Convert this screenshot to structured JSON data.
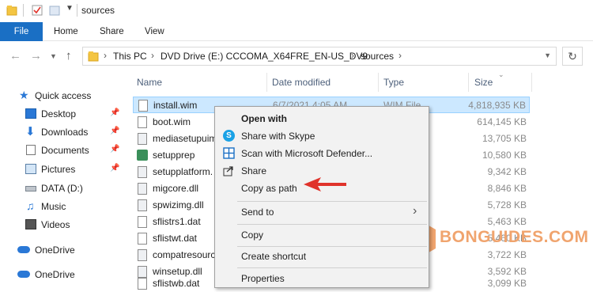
{
  "window": {
    "title": "sources"
  },
  "ribbon": {
    "tabs": [
      "File",
      "Home",
      "Share",
      "View"
    ]
  },
  "address": {
    "crumbs": [
      "This PC",
      "DVD Drive (E:) CCCOMA_X64FRE_EN-US_DV9",
      "sources"
    ]
  },
  "sidebar": {
    "quick_access": "Quick access",
    "items": [
      "Desktop",
      "Downloads",
      "Documents",
      "Pictures",
      "DATA (D:)",
      "Music",
      "Videos",
      "OneDrive",
      "OneDrive"
    ]
  },
  "columns": {
    "name": "Name",
    "date": "Date modified",
    "type": "Type",
    "size": "Size"
  },
  "files": [
    {
      "name": "install.wim",
      "date": "6/7/2021 4:05 AM",
      "type": "WIM File",
      "size": "4,818,935 KB"
    },
    {
      "name": "boot.wim",
      "date": "",
      "type": "",
      "size": "614,145 KB"
    },
    {
      "name": "mediasetupuim",
      "date": "",
      "type": "exten...",
      "size": "13,705 KB"
    },
    {
      "name": "setupprep",
      "date": "",
      "type": "",
      "size": "10,580 KB"
    },
    {
      "name": "setupplatform.",
      "date": "",
      "type": "exten...",
      "size": "9,342 KB"
    },
    {
      "name": "migcore.dll",
      "date": "",
      "type": "exten...",
      "size": "8,846 KB"
    },
    {
      "name": "spwizimg.dll",
      "date": "",
      "type": "exten...",
      "size": "5,728 KB"
    },
    {
      "name": "sflistrs1.dat",
      "date": "",
      "type": "",
      "size": "5,463 KB"
    },
    {
      "name": "sflistwt.dat",
      "date": "",
      "type": "",
      "size": "5,460 KB"
    },
    {
      "name": "compatresourc",
      "date": "",
      "type": "exten...",
      "size": "3,722 KB"
    },
    {
      "name": "winsetup.dll",
      "date": "",
      "type": "exten...",
      "size": "3,592 KB"
    },
    {
      "name": "sflistwb.dat",
      "date": "",
      "type": "",
      "size": "3,099 KB"
    }
  ],
  "context_menu": {
    "open_with": "Open with",
    "share_skype": "Share with Skype",
    "scan": "Scan with Microsoft Defender...",
    "share": "Share",
    "copy_as_path": "Copy as path",
    "send_to": "Send to",
    "copy": "Copy",
    "create_shortcut": "Create shortcut",
    "properties": "Properties"
  },
  "watermark": {
    "text": "BONGUIDES.COM",
    "letter": "B"
  },
  "colors": {
    "accent": "#1a6fc4",
    "selected": "#cce8ff",
    "arrow": "#e0332b",
    "watermark": "#f0a46e"
  }
}
